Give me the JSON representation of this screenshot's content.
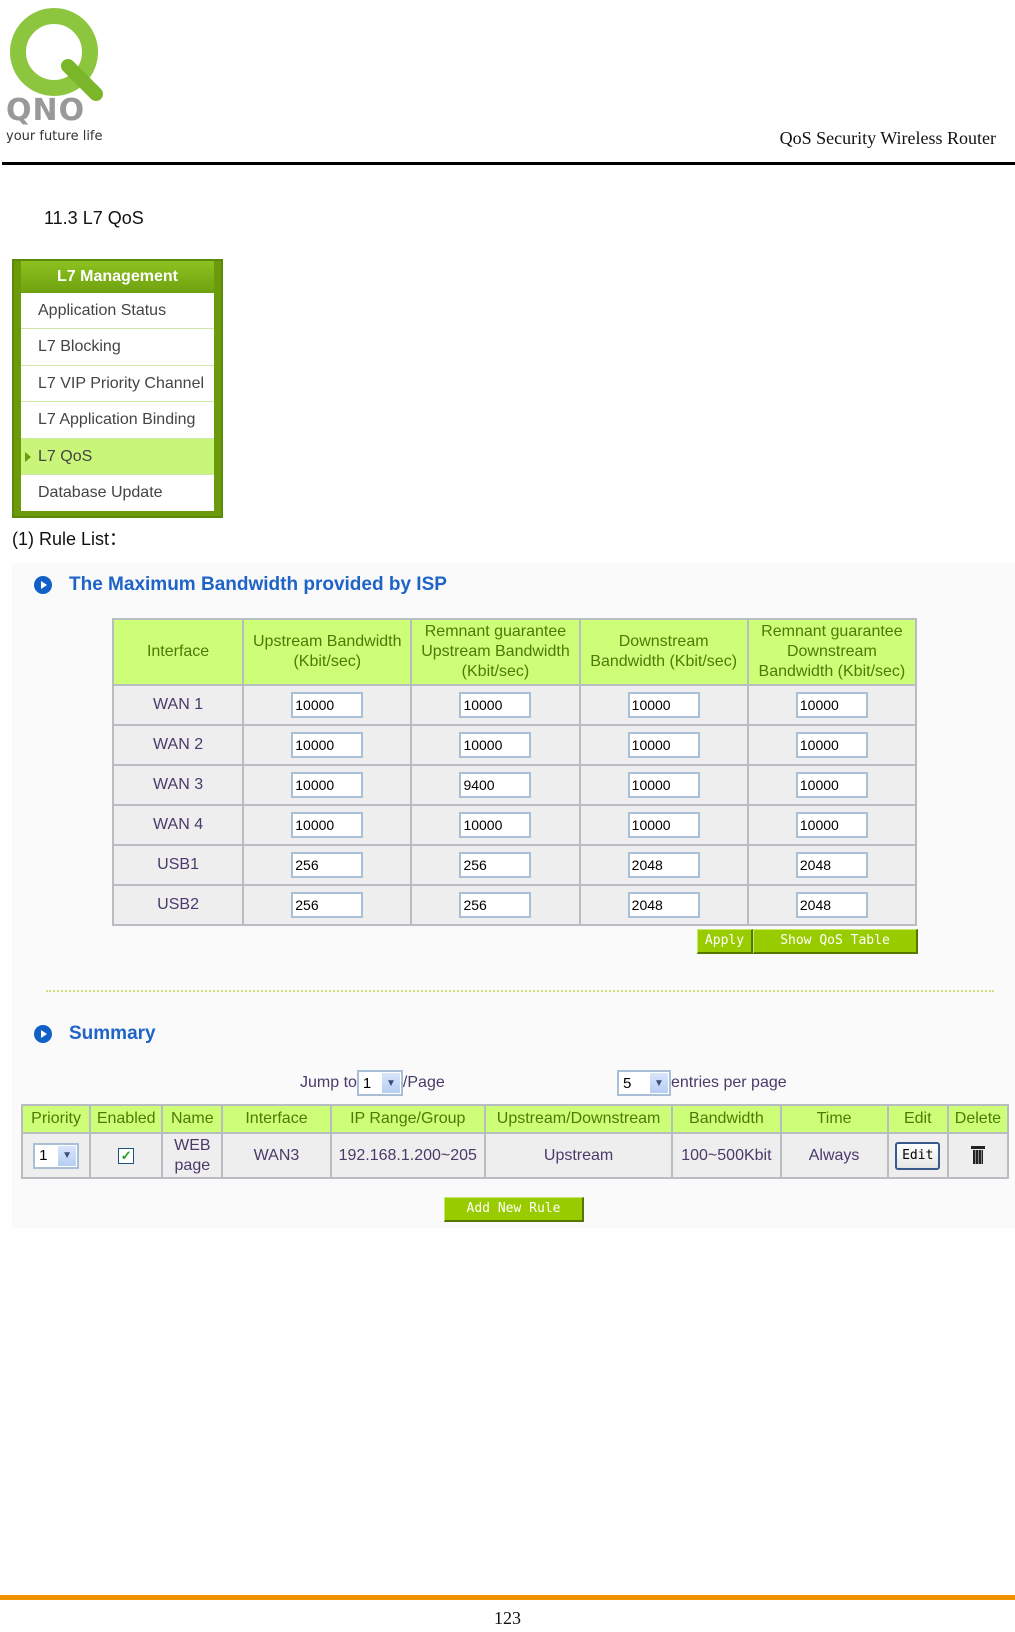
{
  "header": {
    "logo_brand": "QNO",
    "logo_tagline": "your future life",
    "doc_title": "QoS Security Wireless Router"
  },
  "section_heading": "11.3 L7 QoS",
  "menu": {
    "title": "L7 Management",
    "items": [
      {
        "label": "Application Status",
        "active": false
      },
      {
        "label": "L7 Blocking",
        "active": false
      },
      {
        "label": "L7 VIP Priority Channel",
        "active": false
      },
      {
        "label": "L7 Application Binding",
        "active": false
      },
      {
        "label": "L7 QoS",
        "active": true
      },
      {
        "label": "Database Update",
        "active": false
      }
    ]
  },
  "rule_list_label": "(1) Rule List：",
  "bandwidth": {
    "heading": "The Maximum Bandwidth provided by ISP",
    "columns": [
      "Interface",
      "Upstream Bandwidth (Kbit/sec)",
      "Remnant guarantee Upstream Bandwidth (Kbit/sec)",
      "Downstream Bandwidth (Kbit/sec)",
      "Remnant guarantee Downstream Bandwidth (Kbit/sec)"
    ],
    "rows": [
      {
        "interface": "WAN 1",
        "up": "10000",
        "remnant_up": "10000",
        "down": "10000",
        "remnant_down": "10000"
      },
      {
        "interface": "WAN 2",
        "up": "10000",
        "remnant_up": "10000",
        "down": "10000",
        "remnant_down": "10000"
      },
      {
        "interface": "WAN 3",
        "up": "10000",
        "remnant_up": "9400",
        "down": "10000",
        "remnant_down": "10000"
      },
      {
        "interface": "WAN 4",
        "up": "10000",
        "remnant_up": "10000",
        "down": "10000",
        "remnant_down": "10000"
      },
      {
        "interface": "USB1",
        "up": "256",
        "remnant_up": "256",
        "down": "2048",
        "remnant_down": "2048"
      },
      {
        "interface": "USB2",
        "up": "256",
        "remnant_up": "256",
        "down": "2048",
        "remnant_down": "2048"
      }
    ],
    "apply_label": "Apply",
    "show_table_label": "Show QoS Table"
  },
  "summary": {
    "heading": "Summary",
    "jump_to_label": "Jump to",
    "page_value": "1",
    "page_suffix": "/Page",
    "entries_value": "5",
    "entries_label": "entries per page",
    "columns": [
      "Priority",
      "Enabled",
      "Name",
      "Interface",
      "IP Range/Group",
      "Upstream/Downstream",
      "Bandwidth",
      "Time",
      "Edit",
      "Delete"
    ],
    "rows": [
      {
        "priority": "1",
        "enabled": true,
        "name": "WEB page",
        "interface": "WAN3",
        "ip_range": "192.168.1.200~205",
        "direction": "Upstream",
        "bandwidth": "100~500Kbit",
        "time": "Always",
        "edit_label": "Edit"
      }
    ],
    "add_rule_label": "Add New Rule"
  },
  "footer": {
    "page_number": "123",
    "accent_color": "#f39200"
  },
  "colors": {
    "menu_green": "#6b9a0b",
    "active_item": "#c8f57a",
    "header_cell": "#ccff77",
    "heading_blue": "#1e63c8",
    "button_green": "#99cc00"
  }
}
